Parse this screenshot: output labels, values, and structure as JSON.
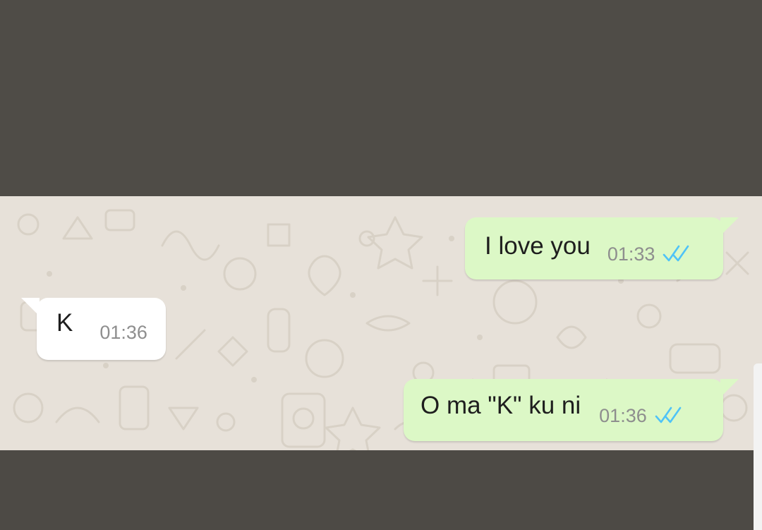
{
  "conversation": {
    "messages": [
      {
        "direction": "outgoing",
        "text": "I love you",
        "time": "01:33",
        "status_icon": "double-check-icon",
        "status": "read"
      },
      {
        "direction": "incoming",
        "text": "K",
        "time": "01:36"
      },
      {
        "direction": "outgoing",
        "text": "O ma \"K\" ku ni",
        "time": "01:36",
        "status_icon": "double-check-icon",
        "status": "read"
      }
    ]
  },
  "colors": {
    "outgoing_bubble": "#dcf8c6",
    "incoming_bubble": "#ffffff",
    "chat_background": "#e7e1d9",
    "read_ticks": "#4fc3f7",
    "surround": "#4f4c47"
  }
}
